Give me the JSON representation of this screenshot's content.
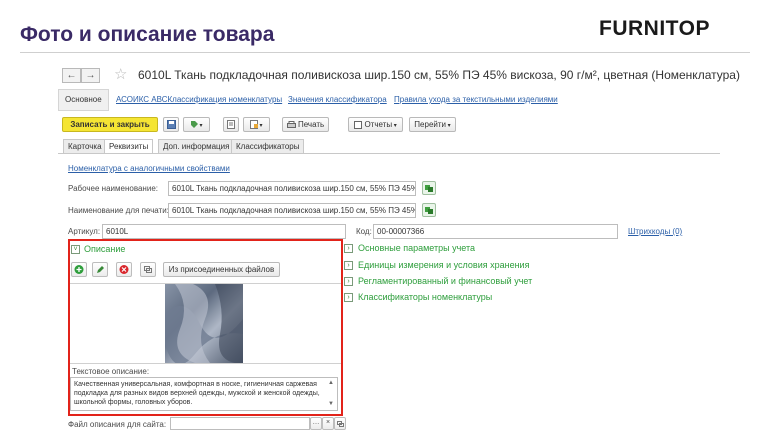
{
  "slide": {
    "title": "Фото и описание товара",
    "brand": "FURNITOP"
  },
  "nav": {
    "back": "←",
    "forward": "→"
  },
  "document": {
    "title": "6010L Ткань подкладочная поливискоза   шир.150 см, 55% ПЭ 45% вискоза, 90 г/м², цветная (Номенклатура)"
  },
  "top_tabs": {
    "main": "Основное",
    "links": [
      "АСОИКС АВСКлассификация номенклатуры",
      "Значения классификатора",
      "Правила ухода за текстильными изделиями"
    ]
  },
  "toolbar": {
    "save_close": "Записать и закрыть",
    "print": "Печать",
    "reports": "Отчеты",
    "goto": "Перейти"
  },
  "inner_tabs": [
    "Карточка",
    "Реквизиты",
    "Доп. информация",
    "Классификаторы"
  ],
  "form": {
    "similar_link": "Номенклатура с аналогичными свойствами",
    "work_name_label": "Рабочее наименование:",
    "work_name_value": "6010L Ткань подкладочная поливискоза   шир.150 см, 55% ПЭ 45%",
    "print_name_label": "Наименование для печати:",
    "print_name_value": "6010L Ткань подкладочная поливискоза   шир.150 см, 55% ПЭ 45%",
    "article_label": "Артикул:",
    "article_value": "6010L",
    "code_label": "Код:",
    "code_value": "00-00007366",
    "barcodes_link": "Штрихкоды (0)"
  },
  "description": {
    "header": "Описание",
    "from_files_button": "Из присоединенных файлов",
    "text_label": "Текстовое описание:",
    "text": "Качественная универсальная, комфортная в носке, гигиеничная саржевая подкладка для разных видов верхней одежды, мужской и женской одежды, школьной формы, головных уборов."
  },
  "sections": [
    "Основные параметры учета",
    "Единицы измерения и условия хранения",
    "Регламентированный и финансовый учет",
    "Классификаторы номенклатуры"
  ],
  "site_file": {
    "label": "Файл описания для сайта:",
    "value": ""
  },
  "colors": {
    "accent_red": "#e2231a",
    "section_green": "#2e9e3c",
    "save_yellow": "#f5e534",
    "title_purple": "#3a2a66"
  }
}
